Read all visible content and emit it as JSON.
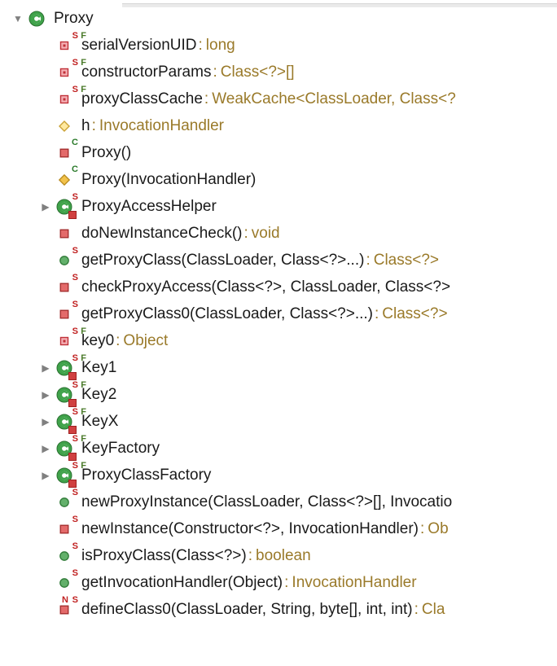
{
  "rows": [
    {
      "indent": 1,
      "arrow": "down",
      "icon": "class",
      "overlays": [],
      "name": "Proxy",
      "type": null
    },
    {
      "indent": 2,
      "arrow": "none",
      "icon": "field-private",
      "overlays": [
        "S",
        "F"
      ],
      "name": "serialVersionUID",
      "type": "long"
    },
    {
      "indent": 2,
      "arrow": "none",
      "icon": "field-private",
      "overlays": [
        "S",
        "F"
      ],
      "name": "constructorParams",
      "type": "Class<?>[]"
    },
    {
      "indent": 2,
      "arrow": "none",
      "icon": "field-private",
      "overlays": [
        "S",
        "F"
      ],
      "name": "proxyClassCache",
      "type": "WeakCache<ClassLoader, Class<?"
    },
    {
      "indent": 2,
      "arrow": "none",
      "icon": "field-protected",
      "overlays": [],
      "name": "h",
      "type": "InvocationHandler"
    },
    {
      "indent": 2,
      "arrow": "none",
      "icon": "method-private",
      "overlays": [
        "C"
      ],
      "name": "Proxy()",
      "type": null
    },
    {
      "indent": 2,
      "arrow": "none",
      "icon": "method-protected",
      "overlays": [
        "C"
      ],
      "name": "Proxy(InvocationHandler)",
      "type": null
    },
    {
      "indent": 2,
      "arrow": "right",
      "icon": "class-priv",
      "overlays": [
        "S"
      ],
      "name": "ProxyAccessHelper",
      "type": null
    },
    {
      "indent": 2,
      "arrow": "none",
      "icon": "method-private",
      "overlays": [],
      "name": "doNewInstanceCheck()",
      "type": "void"
    },
    {
      "indent": 2,
      "arrow": "none",
      "icon": "method-public",
      "overlays": [
        "S"
      ],
      "name": "getProxyClass(ClassLoader, Class<?>...)",
      "type": "Class<?>"
    },
    {
      "indent": 2,
      "arrow": "none",
      "icon": "method-private",
      "overlays": [
        "S"
      ],
      "name": "checkProxyAccess(Class<?>, ClassLoader, Class<?>",
      "type": null,
      "nosep": true
    },
    {
      "indent": 2,
      "arrow": "none",
      "icon": "method-private",
      "overlays": [
        "S"
      ],
      "name": "getProxyClass0(ClassLoader, Class<?>...)",
      "type": "Class<?>"
    },
    {
      "indent": 2,
      "arrow": "none",
      "icon": "field-private",
      "overlays": [
        "S",
        "F"
      ],
      "name": "key0",
      "type": "Object"
    },
    {
      "indent": 2,
      "arrow": "right",
      "icon": "class-priv",
      "overlays": [
        "S",
        "F"
      ],
      "name": "Key1",
      "type": null
    },
    {
      "indent": 2,
      "arrow": "right",
      "icon": "class-priv",
      "overlays": [
        "S",
        "F"
      ],
      "name": "Key2",
      "type": null
    },
    {
      "indent": 2,
      "arrow": "right",
      "icon": "class-priv",
      "overlays": [
        "S",
        "F"
      ],
      "name": "KeyX",
      "type": null
    },
    {
      "indent": 2,
      "arrow": "right",
      "icon": "class-priv",
      "overlays": [
        "S",
        "F"
      ],
      "name": "KeyFactory",
      "type": null
    },
    {
      "indent": 2,
      "arrow": "right",
      "icon": "class-priv",
      "overlays": [
        "S",
        "F"
      ],
      "name": "ProxyClassFactory",
      "type": null
    },
    {
      "indent": 2,
      "arrow": "none",
      "icon": "method-public",
      "overlays": [
        "S"
      ],
      "name": "newProxyInstance(ClassLoader, Class<?>[], Invocatio",
      "type": null,
      "nosep": true
    },
    {
      "indent": 2,
      "arrow": "none",
      "icon": "method-private",
      "overlays": [
        "S"
      ],
      "name": "newInstance(Constructor<?>, InvocationHandler)",
      "type": "Ob"
    },
    {
      "indent": 2,
      "arrow": "none",
      "icon": "method-public",
      "overlays": [
        "S"
      ],
      "name": "isProxyClass(Class<?>)",
      "type": "boolean"
    },
    {
      "indent": 2,
      "arrow": "none",
      "icon": "method-public",
      "overlays": [
        "S"
      ],
      "name": "getInvocationHandler(Object)",
      "type": "InvocationHandler"
    },
    {
      "indent": 2,
      "arrow": "none",
      "icon": "method-private",
      "overlays": [
        "N",
        "S"
      ],
      "name": "defineClass0(ClassLoader, String, byte[], int, int)",
      "type": "Cla"
    }
  ]
}
